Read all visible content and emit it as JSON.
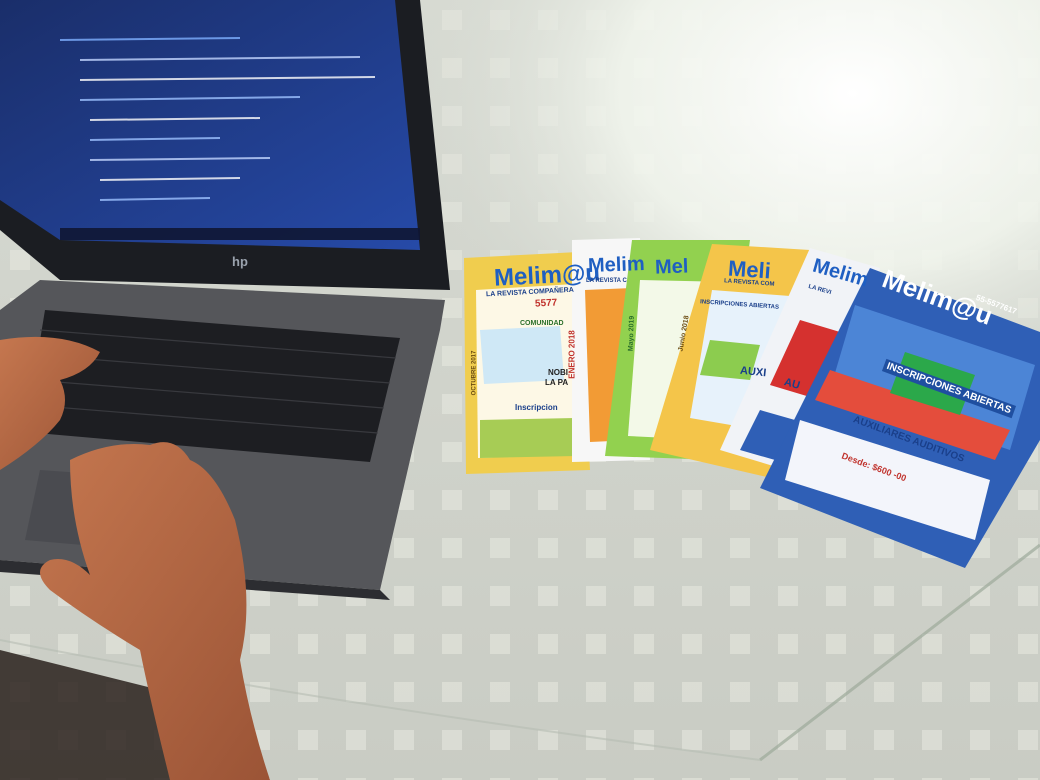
{
  "laptop": {
    "brand": "hp",
    "screen": {
      "content": "code-editor"
    }
  },
  "magazines": [
    {
      "masthead": "Melim@u",
      "tagline": "LA REVISTA COMPAÑERA",
      "phone": "5577",
      "side_label": "OCTUBRE 2017",
      "section": "COMUNIDAD",
      "cover_text_1": "NOBI",
      "cover_text_2": "LA PA",
      "cover_text_3": "Inscripcion",
      "cover_color": "#f2d25a"
    },
    {
      "masthead": "Melim",
      "tagline": "LA REVISTA C",
      "side_label": "ENERO 2018",
      "cover_color": "#f4f4f4"
    },
    {
      "masthead": "Mel",
      "side_label": "Mayo 2019",
      "cover_color": "#9fd85a"
    },
    {
      "masthead": "Meli",
      "tagline": "LA REVISTA COM",
      "cover_text_1": "INSCRIPCIONES ABIERTAS",
      "side_label": "Junio 2018",
      "cover_text_2": "AUXI",
      "cover_color": "#f6c94e"
    },
    {
      "masthead": "Melim",
      "tagline": "LA REVI",
      "cover_text_1": "AU",
      "cover_color": "#e9eef6"
    },
    {
      "masthead": "Melim@u",
      "phone": "55-5577617",
      "cover_text_1": "INSCRIPCIONES ABIERTAS",
      "cover_text_2": "AUXILIARES AUDITIVOS",
      "cover_text_3": "Desde: $600 -00",
      "cover_color": "#2f5fb6"
    }
  ]
}
